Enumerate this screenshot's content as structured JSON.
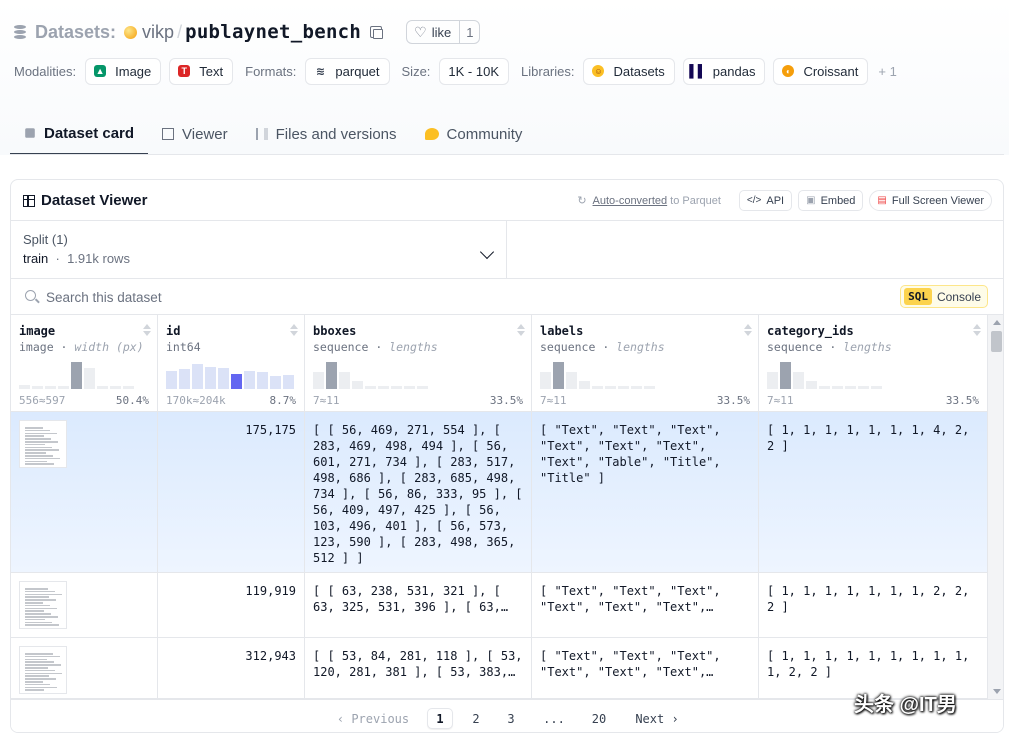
{
  "header": {
    "section_label": "Datasets",
    "owner": "vikp",
    "repo_name": "publaynet_bench",
    "like_label": "like",
    "like_count": "1"
  },
  "meta": {
    "modalities_label": "Modalities:",
    "modalities": [
      "Image",
      "Text"
    ],
    "formats_label": "Formats:",
    "format": "parquet",
    "size_label": "Size:",
    "size": "1K - 10K",
    "libraries_label": "Libraries:",
    "libraries": [
      "Datasets",
      "pandas",
      "Croissant"
    ],
    "libraries_more": "+ 1"
  },
  "tabs": [
    {
      "label": "Dataset card",
      "icon": "cube-icon",
      "active": true
    },
    {
      "label": "Viewer",
      "icon": "table-icon",
      "active": false
    },
    {
      "label": "Files and versions",
      "icon": "files-icon",
      "active": false
    },
    {
      "label": "Community",
      "icon": "community-icon",
      "active": false
    }
  ],
  "viewer": {
    "title": "Dataset Viewer",
    "auto_converted_link": "Auto-converted",
    "auto_converted_suffix": "to Parquet",
    "api_label": "API",
    "embed_label": "Embed",
    "fullscreen_label": "Full Screen Viewer",
    "split_label": "Split (1)",
    "split_name": "train",
    "split_rows": "1.91k rows",
    "search_placeholder": "Search this dataset",
    "sql_badge": "SQL",
    "sql_label": "Console"
  },
  "columns": [
    {
      "name": "image",
      "type": "image",
      "stat": "width (px)",
      "range": "556≈597",
      "pct": "50.4%",
      "hist": [
        0.15,
        0.1,
        0.1,
        0.1,
        0.95,
        0.75,
        0.08,
        0.08,
        0.08
      ],
      "hl": [
        4
      ]
    },
    {
      "name": "id",
      "type": "int64",
      "stat": "",
      "range": "170k≈204k",
      "pct": "8.7%",
      "hist": [
        0.65,
        0.7,
        0.9,
        0.8,
        0.75,
        0.55,
        0.65,
        0.6,
        0.45,
        0.5
      ],
      "hl": [
        5
      ]
    },
    {
      "name": "bboxes",
      "type": "sequence",
      "stat": "lengths",
      "range": "7≈11",
      "pct": "33.5%",
      "hist": [
        0.6,
        0.95,
        0.6,
        0.3,
        0.1,
        0.08,
        0.08,
        0.08,
        0.06
      ],
      "hl": [
        1
      ]
    },
    {
      "name": "labels",
      "type": "sequence",
      "stat": "lengths",
      "range": "7≈11",
      "pct": "33.5%",
      "hist": [
        0.6,
        0.95,
        0.6,
        0.3,
        0.1,
        0.08,
        0.08,
        0.08,
        0.06
      ],
      "hl": [
        1
      ]
    },
    {
      "name": "category_ids",
      "type": "sequence",
      "stat": "lengths",
      "range": "7≈11",
      "pct": "33.5%",
      "hist": [
        0.6,
        0.95,
        0.6,
        0.3,
        0.1,
        0.08,
        0.08,
        0.08,
        0.06
      ],
      "hl": [
        1
      ]
    }
  ],
  "rows": [
    {
      "id": "175,175",
      "bboxes": "[ [ 56, 469, 271, 554 ], [ 283, 469, 498, 494 ], [ 56, 601, 271, 734 ], [ 283, 517, 498, 686 ], [ 283, 685, 498, 734 ], [ 56, 86, 333, 95 ], [ 56, 409, 497, 425 ], [ 56, 103, 496, 401 ], [ 56, 573, 123, 590 ], [ 283, 498, 365, 512 ] ]",
      "labels": "[ \"Text\", \"Text\", \"Text\", \"Text\", \"Text\", \"Text\", \"Text\", \"Table\", \"Title\", \"Title\" ]",
      "category_ids": "[ 1, 1, 1, 1, 1, 1, 1, 4, 2, 2 ]"
    },
    {
      "id": "119,919",
      "bboxes": "[ [ 63, 238, 531, 321 ], [ 63, 325, 531, 396 ], [ 63,…",
      "labels": "[ \"Text\", \"Text\", \"Text\", \"Text\", \"Text\", \"Text\",…",
      "category_ids": "[ 1, 1, 1, 1, 1, 1, 1, 2, 2, 2 ]"
    },
    {
      "id": "312,943",
      "bboxes": "[ [ 53, 84, 281, 118 ], [ 53, 120, 281, 381 ], [ 53, 383,…",
      "labels": "[ \"Text\", \"Text\", \"Text\", \"Text\", \"Text\", \"Text\",…",
      "category_ids": "[ 1, 1, 1, 1, 1, 1, 1, 1, 1, 1, 2, 2 ]"
    }
  ],
  "pagination": {
    "previous": "Previous",
    "pages": [
      "1",
      "2",
      "3",
      "...",
      "20"
    ],
    "current": "1",
    "next": "Next"
  },
  "watermark": "头条 @IT男"
}
